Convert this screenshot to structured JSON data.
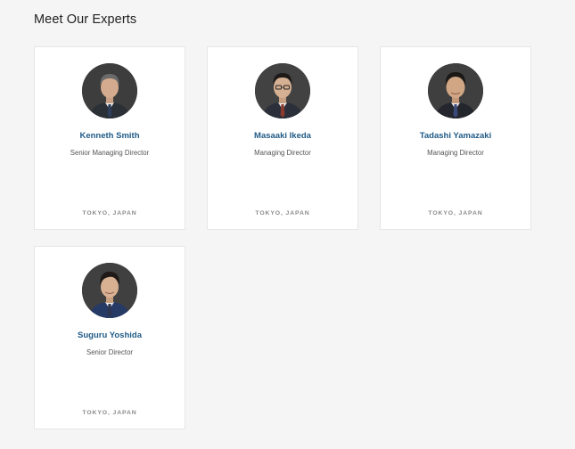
{
  "section": {
    "title": "Meet Our Experts"
  },
  "experts": [
    {
      "name": "Kenneth Smith",
      "role": "Senior Managing Director",
      "location": "TOKYO, JAPAN",
      "avatar_icon": "person-portrait-icon",
      "tie_color": "#2f3e5a",
      "suit_color": "#2b2f36",
      "hair_color": "#6a6a6a"
    },
    {
      "name": "Masaaki Ikeda",
      "role": "Managing Director",
      "location": "TOKYO, JAPAN",
      "avatar_icon": "person-portrait-icon",
      "tie_color": "#8a3b2e",
      "suit_color": "#2a2f3a",
      "hair_color": "#1e1a18"
    },
    {
      "name": "Tadashi Yamazaki",
      "role": "Managing Director",
      "location": "TOKYO, JAPAN",
      "avatar_icon": "person-portrait-icon",
      "tie_color": "#3a4a7a",
      "suit_color": "#23262d",
      "hair_color": "#1b1816"
    },
    {
      "name": "Suguru Yoshida",
      "role": "Senior Director",
      "location": "TOKYO, JAPAN",
      "avatar_icon": "person-portrait-icon",
      "tie_color": "#2c3650",
      "suit_color": "#263a66",
      "hair_color": "#1f1a17"
    }
  ],
  "colors": {
    "name_link": "#1f5a86",
    "page_background": "#f5f5f5",
    "card_background": "#ffffff"
  }
}
